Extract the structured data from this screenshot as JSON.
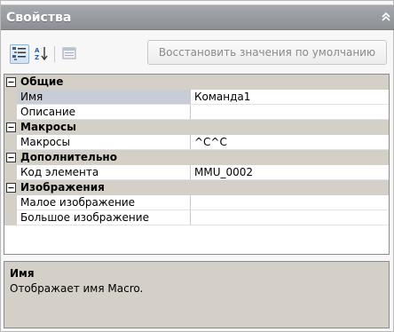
{
  "panel": {
    "title": "Свойства",
    "collapse_icon": "double-chevron-up-icon"
  },
  "toolbar": {
    "categorized_icon": "categorized-view-icon",
    "alphabetical_icon": "alphabetical-sort-icon",
    "property_pages_icon": "property-pages-icon",
    "restore_label": "Восстановить значения по умолчанию"
  },
  "grid": {
    "rows": [
      {
        "type": "category",
        "label": "Общие"
      },
      {
        "type": "property",
        "name": "Имя",
        "value": "Команда1",
        "selected": true
      },
      {
        "type": "property",
        "name": "Описание",
        "value": ""
      },
      {
        "type": "category",
        "label": "Макросы"
      },
      {
        "type": "property",
        "name": "Макросы",
        "value": "^C^C"
      },
      {
        "type": "category",
        "label": "Дополнительно"
      },
      {
        "type": "property",
        "name": "Код элемента",
        "value": "MMU_0002"
      },
      {
        "type": "category",
        "label": "Изображения"
      },
      {
        "type": "property",
        "name": "Малое изображение",
        "value": ""
      },
      {
        "type": "property",
        "name": "Большое изображение",
        "value": ""
      }
    ]
  },
  "description": {
    "title": "Имя",
    "text": "Отображает имя Macro."
  }
}
